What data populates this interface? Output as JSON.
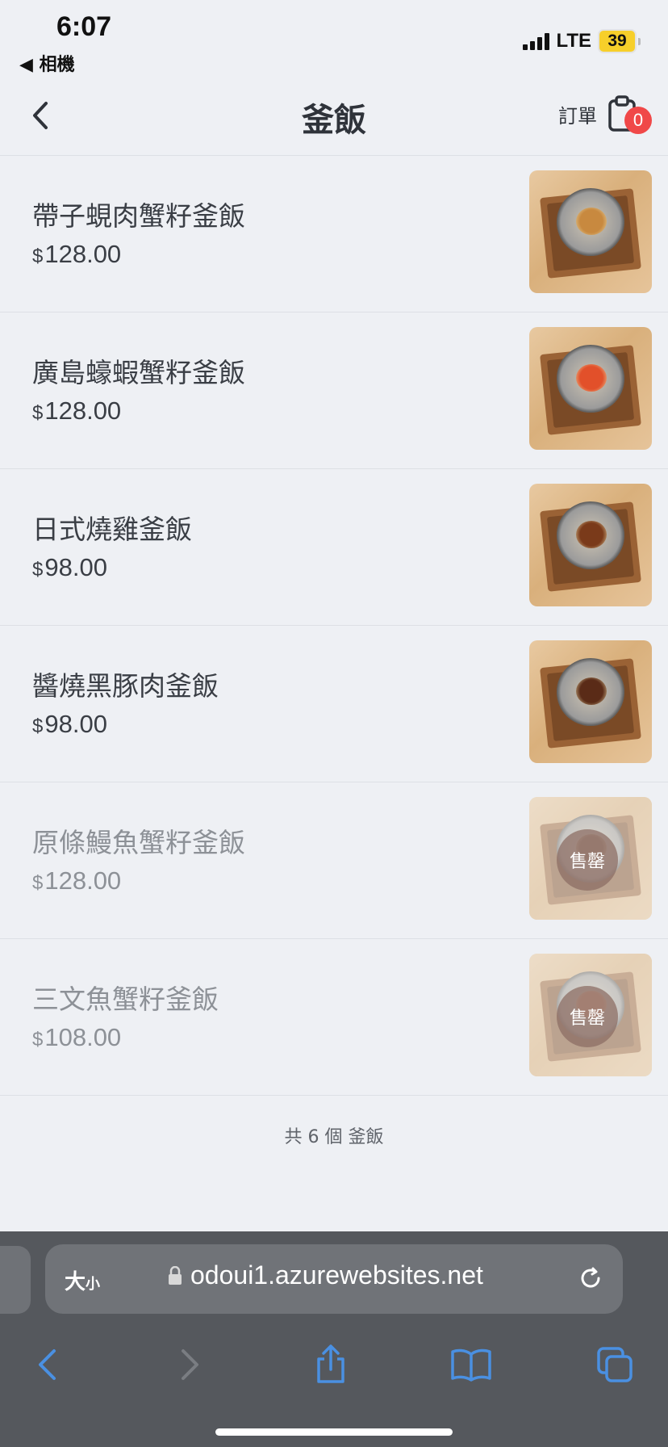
{
  "status_bar": {
    "time": "6:07",
    "back_app": "◀ 相機",
    "network": "LTE",
    "battery": "39"
  },
  "header": {
    "title": "釜飯",
    "order_label": "訂單",
    "cart_count": "0"
  },
  "items": [
    {
      "name": "帶子蜆肉蟹籽釜飯",
      "currency": "$",
      "price": "128.00",
      "sold_out": false,
      "topping_color": "#c8893f"
    },
    {
      "name": "廣島蠔蝦蟹籽釜飯",
      "currency": "$",
      "price": "128.00",
      "sold_out": false,
      "topping_color": "#e2502a"
    },
    {
      "name": "日式燒雞釜飯",
      "currency": "$",
      "price": "98.00",
      "sold_out": false,
      "topping_color": "#7a3a1a"
    },
    {
      "name": "醬燒黑豚肉釜飯",
      "currency": "$",
      "price": "98.00",
      "sold_out": false,
      "topping_color": "#5a2b17"
    },
    {
      "name": "原條鰻魚蟹籽釜飯",
      "currency": "$",
      "price": "128.00",
      "sold_out": true,
      "sold_label": "售罄",
      "topping_color": "#6b3a20"
    },
    {
      "name": "三文魚蟹籽釜飯",
      "currency": "$",
      "price": "108.00",
      "sold_out": true,
      "sold_label": "售罄",
      "topping_color": "#d96a40"
    }
  ],
  "footer_count": "共 6 個 釜飯",
  "browser": {
    "text_size": "大",
    "text_size_small": "小",
    "url": "odoui1.azurewebsites.net"
  },
  "colors": {
    "badge": "#f04848",
    "safari_accent": "#4a90e2"
  }
}
